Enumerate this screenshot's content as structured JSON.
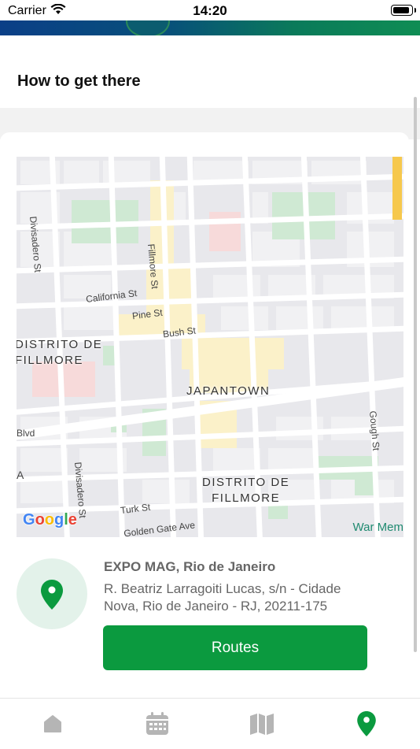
{
  "status_bar": {
    "carrier": "Carrier",
    "time": "14:20"
  },
  "header": {
    "title": "How to get there"
  },
  "map": {
    "labels": {
      "fillmore_st": "Fillmore St",
      "divisadero_st_top": "Divisadero St",
      "divisadero_st_bottom": "Divisadero St",
      "california_st": "California St",
      "pine_st": "Pine St",
      "bush_st": "Bush St",
      "gough_st": "Gough St",
      "turk_st": "Turk St",
      "golden_gate_ave": "Golden Gate Ave",
      "blvd": "Blvd",
      "edge_a": "A"
    },
    "districts": {
      "distrito_fillmore_left": "DISTRITO DE\nFILLMORE",
      "japantown": "JAPANTOWN",
      "distrito_fillmore_bottom": "DISTRITO DE\nFILLMORE"
    },
    "attribution": "Google",
    "corner_label": "War Mem"
  },
  "venue": {
    "name": "EXPO MAG, Rio de Janeiro",
    "address": "R. Beatriz Larragoiti Lucas, s/n - Cidade Nova, Rio de Janeiro - RJ, 20211-175"
  },
  "routes_button": {
    "label": "Routes"
  },
  "tabbar": {
    "tabs": [
      {
        "icon": "home-icon",
        "active": false
      },
      {
        "icon": "calendar-icon",
        "active": false
      },
      {
        "icon": "map-icon",
        "active": false
      },
      {
        "icon": "location-pin-icon",
        "active": true
      }
    ]
  },
  "colors": {
    "accent": "#0b9a3f",
    "pin_bg": "#e3f2ea",
    "tab_inactive": "#b5b5b5"
  }
}
